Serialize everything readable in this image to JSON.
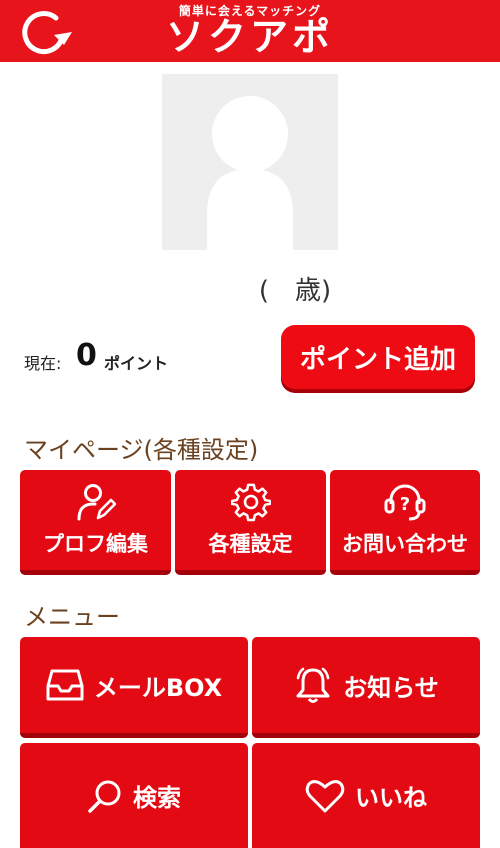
{
  "header": {
    "tagline": "簡単に会えるマッチング",
    "logo_text": "ソクアポ"
  },
  "profile": {
    "age_text": "(　歳)"
  },
  "points": {
    "label": "現在:",
    "value": "0",
    "unit": "ポイント",
    "add_button": "ポイント追加"
  },
  "mypage": {
    "title": "マイページ(各種設定)",
    "items": [
      {
        "label": "プロフ編集",
        "icon": "profile-edit-icon"
      },
      {
        "label": "各種設定",
        "icon": "gear-icon"
      },
      {
        "label": "お問い合わせ",
        "icon": "support-headset-icon"
      }
    ]
  },
  "menu": {
    "title": "メニュー",
    "items": [
      {
        "label": "メールBOX",
        "icon": "inbox-icon"
      },
      {
        "label": "お知らせ",
        "icon": "bell-icon"
      },
      {
        "label": "検索",
        "icon": "search-icon"
      },
      {
        "label": "いいね",
        "icon": "heart-icon"
      }
    ]
  },
  "colors": {
    "brand_red": "#e8141b",
    "section_title": "#6b4220"
  }
}
